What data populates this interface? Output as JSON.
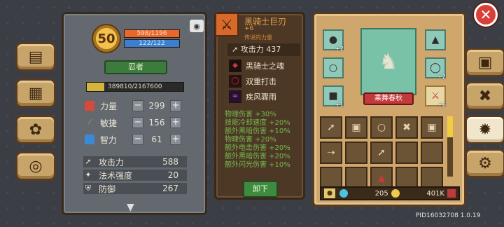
{
  "player": {
    "level": "50",
    "hp": "598/1196",
    "mp": "122/122",
    "class_name": "忍者",
    "exp": "389810/2167600",
    "stats": [
      {
        "label": "力量",
        "value": "299",
        "icon": "fist-icon",
        "color": "#d64a3a"
      },
      {
        "label": "敏捷",
        "value": "156",
        "icon": "feather-icon",
        "color": "#5cbf4a"
      },
      {
        "label": "智力",
        "value": "61",
        "icon": "book-icon",
        "color": "#3a8ad6"
      }
    ],
    "attributes": [
      {
        "label": "攻击力",
        "value": "588",
        "icon": "sword-icon"
      },
      {
        "label": "法术强度",
        "value": "20",
        "icon": "wand-icon"
      },
      {
        "label": "防御",
        "value": "267",
        "icon": "shield-icon"
      }
    ]
  },
  "item": {
    "name": "黑骑士巨刃",
    "plus": "+6",
    "subtitle": "传说的力量",
    "attack": "攻击力 437",
    "skills": [
      {
        "name": "黑骑士之魂",
        "icon": "dark-soul-icon",
        "color": "#1a1010"
      },
      {
        "name": "双重打击",
        "icon": "double-strike-icon",
        "color": "#c23a3a"
      },
      {
        "name": "疾风骤雨",
        "icon": "storm-icon",
        "color": "#9a4ad0"
      }
    ],
    "bonuses": [
      "物理伤害 +30%",
      "技能冷却速度 +20%",
      "额外黑暗伤害 +10%",
      "物理伤害 +20%",
      "额外电击伤害 +20%",
      "额外黑暗伤害 +20%",
      "额外闪光伤害 +10%"
    ],
    "unequip_label": "卸下"
  },
  "equipment": {
    "set_name": "乘舞春秋",
    "slots": [
      {
        "name": "helmet-slot",
        "tag": "+2"
      },
      {
        "name": "necklace-slot",
        "tag": ""
      },
      {
        "name": "gloves-slot",
        "tag": "+1"
      },
      {
        "name": "armor-slot",
        "tag": ""
      },
      {
        "name": "ring-slot",
        "tag": "+2"
      },
      {
        "name": "weapon-slot",
        "tag": "+6"
      }
    ]
  },
  "resources": {
    "gems": "205",
    "gold": "401K"
  },
  "footer": {
    "pid": "PID16032708 1.0.19"
  },
  "colors": {
    "hp_bar": "#e8672c",
    "mp_bar": "#3b7fd0",
    "bonus_text": "#74b94f",
    "weapon_name": "#e7a24d"
  }
}
